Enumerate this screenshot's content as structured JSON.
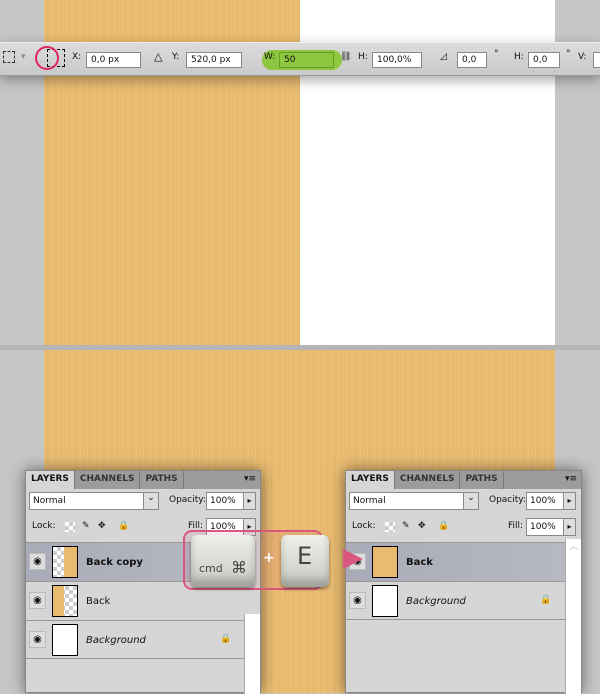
{
  "toolbar": {
    "x_label": "X:",
    "x_value": "0,0 px",
    "y_label": "Y:",
    "y_value": "520,0 px",
    "w_label": "W:",
    "w_value": "50",
    "h_label": "H:",
    "h_value": "100,0%",
    "angle_value": "0,0",
    "deg": "°",
    "hskew_label": "H:",
    "hskew_value": "0,0",
    "deg2": "°",
    "v_label": "V:",
    "highlight_color": "#8dc63f",
    "circle_color": "#e0245e"
  },
  "panel_left": {
    "tabs": [
      "LAYERS",
      "CHANNELS",
      "PATHS"
    ],
    "blend_mode": "Normal",
    "opacity_label": "Opacity:",
    "opacity": "100%",
    "lock_label": "Lock:",
    "fill_label": "Fill:",
    "fill": "100%",
    "layers": [
      {
        "name": "Back copy",
        "selected": true
      },
      {
        "name": "Back"
      },
      {
        "name": "Background",
        "locked": true
      }
    ]
  },
  "panel_right": {
    "tabs": [
      "LAYERS",
      "CHANNELS",
      "PATHS"
    ],
    "blend_mode": "Normal",
    "opacity_label": "Opacity:",
    "opacity": "100%",
    "lock_label": "Lock:",
    "fill_label": "Fill:",
    "fill": "100%",
    "layers": [
      {
        "name": "Back",
        "selected": true
      },
      {
        "name": "Background",
        "locked": true
      }
    ]
  },
  "shortcut": {
    "key1_label": "cmd",
    "key1_symbol": "⌘",
    "plus": "+",
    "key2": "E",
    "accent": "#d9577f"
  }
}
